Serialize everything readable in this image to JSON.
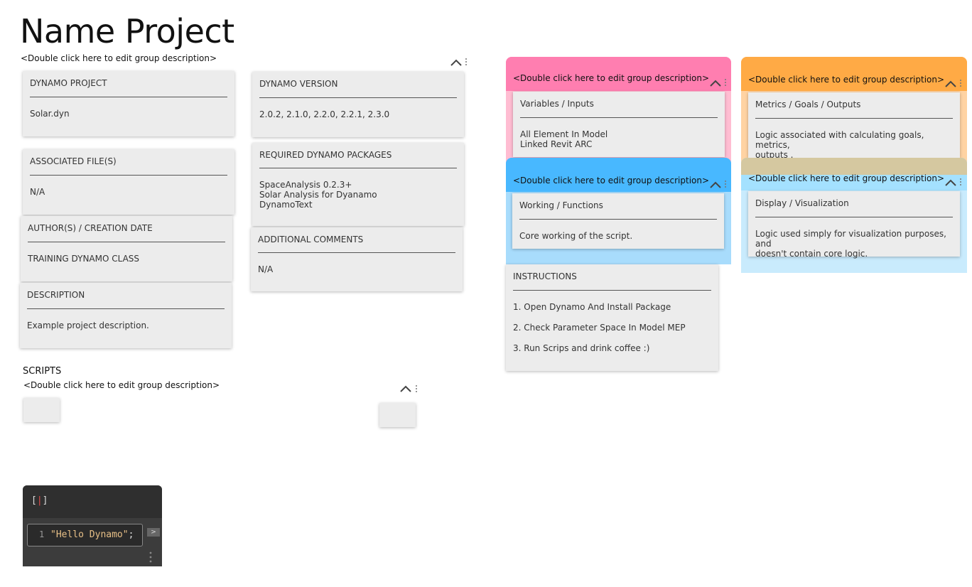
{
  "page": {
    "title": "Name Project"
  },
  "group_desc_placeholder": "<Double click here to edit group description>",
  "notes_left": [
    {
      "header": "DYNAMO PROJECT",
      "body": "Solar.dyn"
    },
    {
      "header": "ASSOCIATED FILE(S)",
      "body": "N/A"
    },
    {
      "header": "AUTHOR(S) / CREATION DATE",
      "body": "TRAINING DYNAMO CLASS"
    },
    {
      "header": "DESCRIPTION",
      "body": "Example project description."
    }
  ],
  "notes_right": [
    {
      "header": "DYNAMO VERSION",
      "body": "2.0.2, 2.1.0, 2.2.0, 2.2.1, 2.3.0"
    },
    {
      "header": "REQUIRED DYNAMO PACKAGES",
      "body": "SpaceAnalysis 0.2.3+\nSolar Analysis for Dyanamo\nDynamoText"
    },
    {
      "header": "ADDITIONAL COMMENTS",
      "body": "N/A"
    }
  ],
  "legend_groups": {
    "inputs": {
      "header": "Variables / Inputs",
      "body": "All Element In Model\nLinked Revit ARC",
      "color": "#ff7eb0"
    },
    "outputs": {
      "header": "Metrics / Goals / Outputs",
      "body": "Logic associated with calculating goals, metrics,\noutputs .",
      "color": "#ffaa45"
    },
    "functions": {
      "header": "Working / Functions",
      "body": "Core working of the script.",
      "color": "#48b8ff"
    },
    "display": {
      "header": "Display / Visualization",
      "body": "Logic used simply for visualization purposes, and\ndoesn't contain core logic.",
      "color": "#a4e1ff"
    }
  },
  "instructions": {
    "header": "INSTRUCTIONS",
    "steps": [
      "1. Open Dynamo And Install Package",
      "2. Check Parameter Space In Model MEP",
      "3. Run Scrips and drink coffee :)"
    ]
  },
  "scripts_group": {
    "title": "SCRIPTS"
  },
  "code_block": {
    "bracket_left": "[",
    "bracket_right": "]",
    "line_number": "1",
    "code": "\"Hello Dynamo\"",
    "semicolon": ";",
    "run_label": ">"
  },
  "icons": {
    "collapse": "chevron-up-icon",
    "more": "kebab-dots-icon"
  }
}
